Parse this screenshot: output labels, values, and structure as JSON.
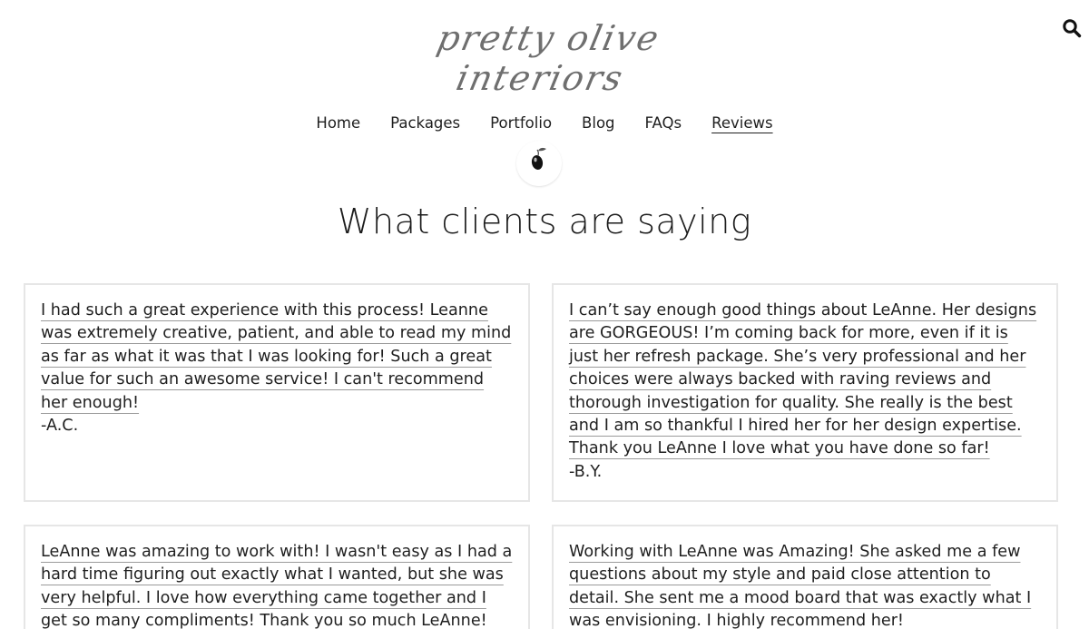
{
  "site": {
    "logo_text": "pretty olive interiors"
  },
  "icons": {
    "search": "search-icon",
    "olive": "olive-icon"
  },
  "nav": {
    "items": [
      {
        "label": "Home"
      },
      {
        "label": "Packages"
      },
      {
        "label": "Portfolio"
      },
      {
        "label": "Blog"
      },
      {
        "label": "FAQs"
      },
      {
        "label": "Reviews",
        "active": true
      }
    ]
  },
  "page": {
    "heading": "What clients are saying"
  },
  "reviews": [
    {
      "text": "I had such a great experience with this process! Leanne was extremely creative, patient, and able to read my mind as far as what it was that I was looking for! Such a great value for such an awesome service! I can't recommend her enough!",
      "author": "-A.C."
    },
    {
      "text": "I can’t say enough good things about LeAnne. Her designs are GORGEOUS! I’m coming back for more, even if it is just her refresh package. She’s very professional and her choices were always backed with raving reviews and thorough investigation for quality. She really is the best and I am so thankful I hired her for her design expertise. Thank you LeAnne I love what you have done so far!",
      "author": "-B.Y."
    },
    {
      "text": "LeAnne was amazing to work with! I wasn't easy as I had a hard time figuring out exactly what I wanted, but she was very helpful. I love how everything came together and I get so many compliments! Thank you so much LeAnne!",
      "author": ""
    },
    {
      "text": "Working with LeAnne was Amazing! She asked me a few questions about my style and paid close attention to detail. She sent me a mood board that was exactly what I was envisioning. I highly recommend her!",
      "author": ""
    }
  ],
  "colors": {
    "text": "#1f1f1f",
    "border": "#e6e6e6",
    "logo": "#6f6f6f"
  }
}
